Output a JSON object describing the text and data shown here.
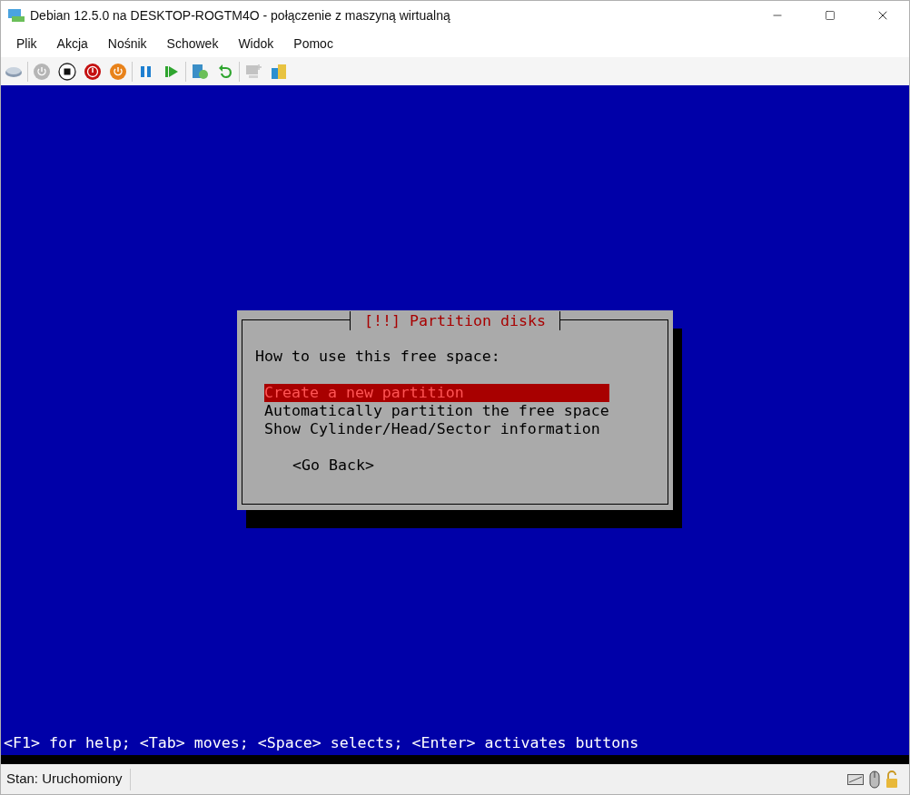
{
  "window": {
    "title": "Debian 12.5.0 na DESKTOP-ROGTM4O - połączenie z maszyną wirtualną"
  },
  "menu": [
    "Plik",
    "Akcja",
    "Nośnik",
    "Schowek",
    "Widok",
    "Pomoc"
  ],
  "toolbar": [
    {
      "kind": "ctrl-alt-del",
      "disabled": false
    },
    {
      "kind": "start",
      "disabled": true
    },
    {
      "kind": "stop",
      "disabled": false
    },
    {
      "kind": "shutdown",
      "disabled": false
    },
    {
      "kind": "save",
      "disabled": false
    },
    {
      "kind": "pause",
      "disabled": false
    },
    {
      "kind": "resume",
      "disabled": false
    },
    {
      "kind": "checkpoint",
      "disabled": false
    },
    {
      "kind": "revert",
      "disabled": false
    },
    {
      "kind": "enhanced",
      "disabled": true
    },
    {
      "kind": "share",
      "disabled": false
    }
  ],
  "dialog": {
    "title": "[!!] Partition disks",
    "prompt": "How to use this free space:",
    "items": [
      {
        "label": "Create a new partition",
        "selected": true
      },
      {
        "label": "Automatically partition the free space",
        "selected": false
      },
      {
        "label": "Show Cylinder/Head/Sector information",
        "selected": false
      }
    ],
    "button": "<Go Back>"
  },
  "hint": "<F1> for help; <Tab> moves; <Space> selects; <Enter> activates buttons",
  "status_bar": {
    "text": "Stan: Uruchomiony"
  }
}
